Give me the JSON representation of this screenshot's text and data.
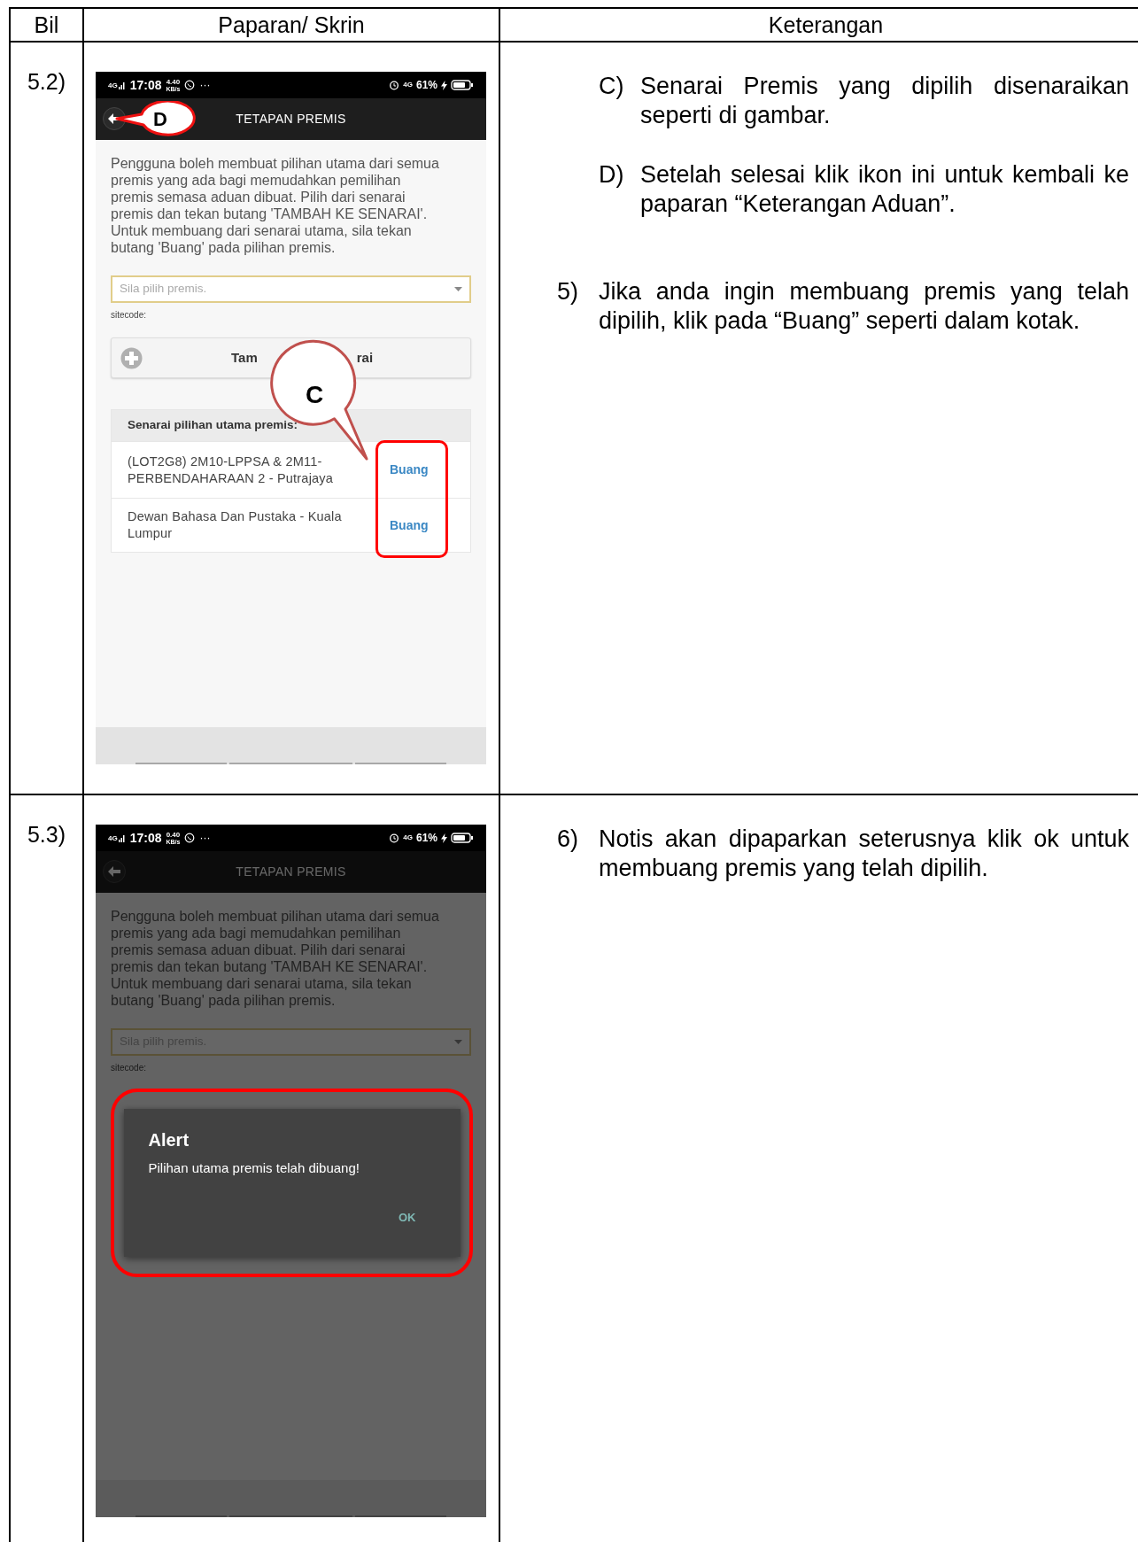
{
  "table": {
    "columns": [
      "Bil",
      "Paparan/ Skrin",
      "Keterangan"
    ],
    "rows": [
      {
        "number": "5.2)",
        "screen": {
          "dimmed": false,
          "status": {
            "network": "4G",
            "time": "17:08",
            "speed": "4.40",
            "speed_unit": "KB/s",
            "more": "···",
            "network_right": "4G",
            "battery": "61%"
          },
          "title": "TETAPAN PREMIS",
          "intro": "Pengguna boleh membuat pilihan utama dari semua premis yang ada bagi memudahkan pemilihan premis semasa aduan dibuat. Pilih dari senarai premis dan tekan butang 'TAMBAH KE SENARAI'. Untuk membuang dari senarai utama, sila tekan butang 'Buang' pada pilihan premis.",
          "select_placeholder": "Sila pilih premis.",
          "field_label": "sitecode:",
          "add_button": {
            "label_start": "Tam",
            "label_end": "rai"
          },
          "list_header": "Senarai pilihan utama premis:",
          "list": [
            {
              "name": "(LOT2G8) 2M10-LPPSA & 2M11-PERBENDAHARAAN 2 - Putrajaya",
              "action": "Buang"
            },
            {
              "name": "Dewan Bahasa Dan Pustaka - Kuala Lumpur",
              "action": "Buang"
            }
          ],
          "callouts": [
            {
              "kind": "ring",
              "letter": "D"
            },
            {
              "kind": "bubble",
              "letter": "C"
            }
          ]
        },
        "notes": [
          {
            "kind": "sub",
            "marker": "C)",
            "text": "Senarai Premis yang dipilih disenaraikan seperti di gambar."
          },
          {
            "kind": "sub",
            "marker": "D)",
            "text": "Setelah selesai klik ikon ini untuk kembali ke paparan “Keterangan Aduan”."
          },
          {
            "kind": "step",
            "marker": "5)",
            "text": "Jika anda ingin membuang premis yang telah dipilih, klik pada “Buang” seperti dalam kotak."
          }
        ]
      },
      {
        "number": "5.3)",
        "screen": {
          "dimmed": true,
          "status": {
            "network": "4G",
            "time": "17:08",
            "speed": "0.40",
            "speed_unit": "KB/s",
            "more": "···",
            "network_right": "4G",
            "battery": "61%"
          },
          "title": "TETAPAN PREMIS",
          "intro": "Pengguna boleh membuat pilihan utama dari semua premis yang ada bagi memudahkan pemilihan premis semasa aduan dibuat. Pilih dari senarai premis dan tekan butang 'TAMBAH KE SENARAI'. Untuk membuang dari senarai utama, sila tekan butang 'Buang' pada pilihan premis.",
          "select_placeholder": "Sila pilih premis.",
          "field_label": "sitecode:",
          "dialog": {
            "title": "Alert",
            "message": "Pilihan utama premis telah dibuang!",
            "button": "OK"
          }
        },
        "notes": [
          {
            "kind": "step",
            "marker": "6)",
            "text": "Notis akan dipaparkan seterusnya klik ok untuk membuang premis yang telah dipilih."
          }
        ]
      }
    ]
  }
}
